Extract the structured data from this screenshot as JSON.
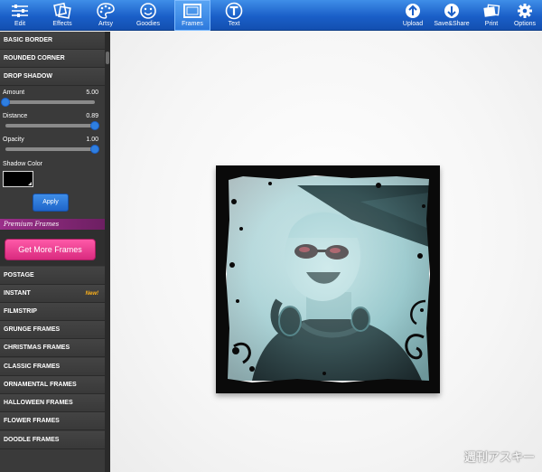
{
  "toolbar": {
    "left_tools": [
      {
        "label": "Edit",
        "icon": "sliders-icon"
      },
      {
        "label": "Effects",
        "icon": "photos-icon"
      },
      {
        "label": "Artsy",
        "icon": "palette-icon"
      },
      {
        "label": "Goodies",
        "icon": "smiley-icon"
      },
      {
        "label": "Frames",
        "icon": "frame-icon",
        "active": true
      },
      {
        "label": "Text",
        "icon": "text-icon"
      }
    ],
    "right_tools": [
      {
        "label": "Upload",
        "icon": "upload-icon"
      },
      {
        "label": "Save&Share",
        "icon": "save-share-icon"
      },
      {
        "label": "Print",
        "icon": "print-icon"
      },
      {
        "label": "Options",
        "icon": "gear-icon"
      }
    ]
  },
  "sidebar": {
    "top_items": [
      "BASIC BORDER",
      "ROUNDED CORNER",
      "DROP SHADOW"
    ],
    "sliders": [
      {
        "label": "Amount",
        "value": "5.00",
        "fraction": 0.0
      },
      {
        "label": "Distance",
        "value": "0.89",
        "fraction": 1.0
      },
      {
        "label": "Opacity",
        "value": "1.00",
        "fraction": 1.0
      }
    ],
    "shadow_color_label": "Shadow Color",
    "shadow_color": "#000000",
    "apply_label": "Apply",
    "premium_label": "Premium Frames",
    "get_more_label": "Get More Frames",
    "frame_items": [
      {
        "label": "POSTAGE"
      },
      {
        "label": "INSTANT",
        "badge": "New!"
      },
      {
        "label": "FILMSTRIP"
      },
      {
        "label": "GRUNGE FRAMES"
      },
      {
        "label": "CHRISTMAS FRAMES"
      },
      {
        "label": "CLASSIC FRAMES"
      },
      {
        "label": "ORNAMENTAL FRAMES"
      },
      {
        "label": "HALLOWEEN FRAMES"
      },
      {
        "label": "FLOWER FRAMES"
      },
      {
        "label": "DOODLE FRAMES"
      }
    ]
  },
  "canvas": {
    "watermark": "週刊アスキー"
  },
  "colors": {
    "toolbar": "#1a5fc8",
    "sidebar": "#3a3a3a",
    "accent": "#2f7fe0",
    "premium": "#9b2f8a",
    "get_more": "#e0358a",
    "new_badge": "#ffb21a"
  }
}
